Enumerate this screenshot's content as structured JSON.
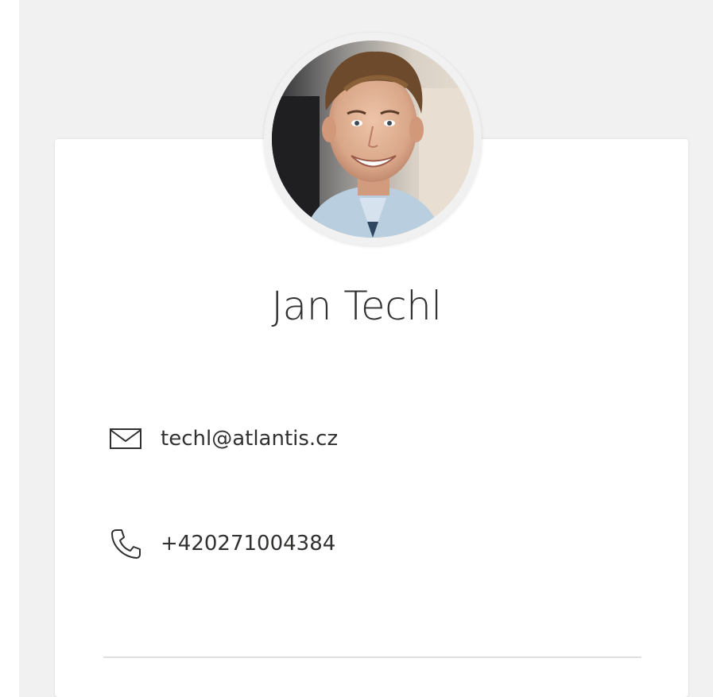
{
  "profile": {
    "name": "Jan Techl",
    "avatar_icon": "profile-photo",
    "email": "techl@atlantis.cz",
    "email_icon": "mail-icon",
    "phone": "+420271004384",
    "phone_icon": "phone-icon"
  },
  "colors": {
    "page_background": "#f1f1f1",
    "card_background": "#ffffff",
    "text": "#323130",
    "divider": "#e1dfdd"
  }
}
